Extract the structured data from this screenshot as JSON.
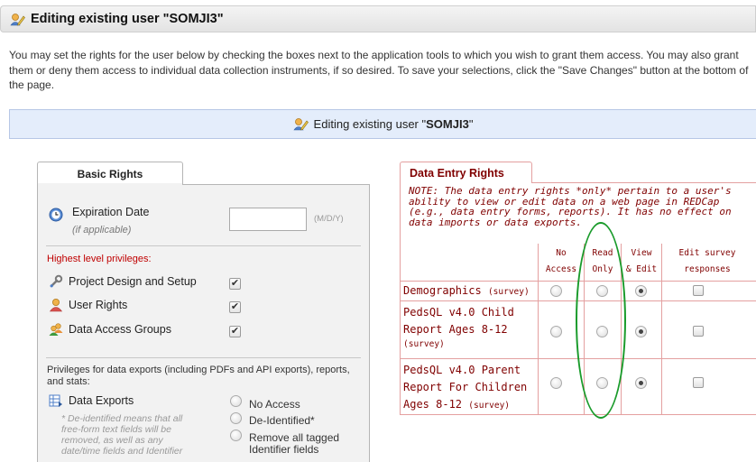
{
  "header": {
    "title": "Editing existing user \"SOMJI3\""
  },
  "intro": {
    "text": "You may set the rights for the user below by checking the boxes next to the application tools to which you wish to grant them access. You may also grant them or deny them access to individual data collection instruments, if so desired. To save your selections, click the \"Save Changes\" button at the bottom of the page."
  },
  "banner": {
    "prefix": "Editing existing user \"",
    "username": "SOMJI3",
    "suffix": "\""
  },
  "basic": {
    "tab_label": "Basic Rights",
    "expiration_label": "Expiration Date",
    "expiration_sub": "(if applicable)",
    "expiration_value": "",
    "date_format": "(M/D/Y)",
    "highest_label": "Highest level privileges:",
    "privileges": [
      {
        "label": "Project Design and Setup",
        "icon": "wrench-icon",
        "checked": true
      },
      {
        "label": "User Rights",
        "icon": "user-icon",
        "checked": true
      },
      {
        "label": "Data Access Groups",
        "icon": "group-icon",
        "checked": true
      }
    ],
    "export_section_label": "Privileges for data exports (including PDFs and API exports), reports, and stats:",
    "data_exports_label": "Data Exports",
    "deid_note": "* De-identified means that all free-form text fields will be removed, as well as any date/time fields and Identifier",
    "export_options": [
      "No Access",
      "De-Identified*",
      "Remove all tagged Identifier fields"
    ],
    "checkmark": "✔"
  },
  "data_entry": {
    "tab_label": "Data Entry Rights",
    "note": "NOTE: The data entry rights *only* pertain to a user's ability to view or edit data on a web page in REDCap (e.g., data entry forms, reports). It has no effect on data imports or data exports.",
    "columns": [
      {
        "line1": "No",
        "line2": "Access"
      },
      {
        "line1": "Read",
        "line2": "Only"
      },
      {
        "line1": "View",
        "line2": "& Edit"
      },
      {
        "line1": "Edit survey",
        "line2": "responses"
      }
    ],
    "instruments": [
      {
        "lines": [
          "Demographics"
        ],
        "tag": "(survey)",
        "selected": "View & Edit",
        "survey_edit": false
      },
      {
        "lines": [
          "PedsQL v4.0 Child",
          "Report Ages 8-12"
        ],
        "tag": "(survey)",
        "selected": "View & Edit",
        "survey_edit": false
      },
      {
        "lines": [
          "PedsQL v4.0 Parent",
          "Report For Children",
          "Ages 8-12"
        ],
        "tag": "(survey)",
        "selected": "View & Edit",
        "survey_edit": false
      }
    ]
  },
  "colors": {
    "data_entry_accent": "#800000",
    "annotation": "#1a9b2b",
    "banner_bg": "#e4edfb"
  }
}
